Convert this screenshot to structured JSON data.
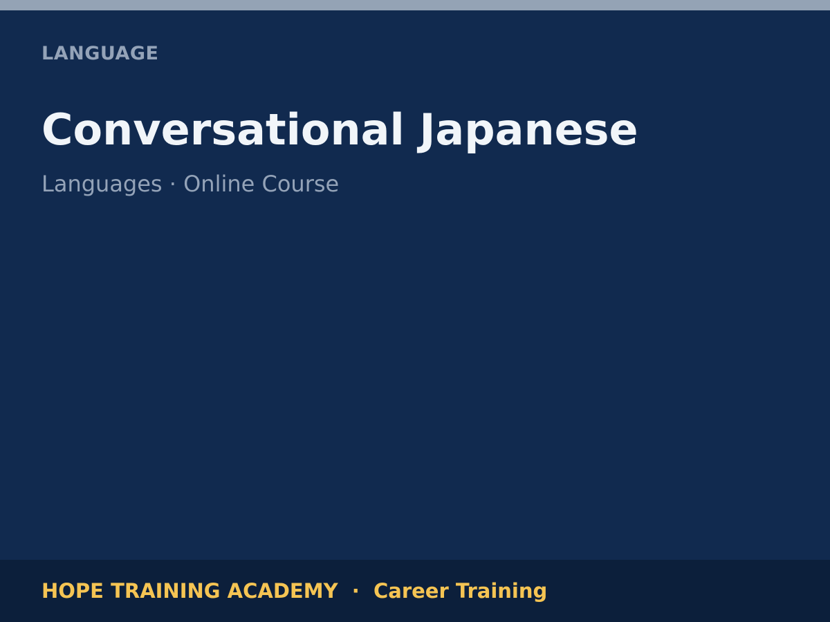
{
  "header": {
    "kicker": "LANGUAGE",
    "title": "Conversational Japanese",
    "subtitle": "Languages · Online Course"
  },
  "footer": {
    "organization": "HOPE TRAINING ACADEMY",
    "separator": "  ·  ",
    "program": "Career Training"
  },
  "colors": {
    "background": "#112a4f",
    "top_bar": "#94a3b5",
    "footer_background": "#0c1f3b",
    "accent": "#f5c453",
    "title_text": "#f1f5f9",
    "muted_text": "#94a3b8"
  }
}
